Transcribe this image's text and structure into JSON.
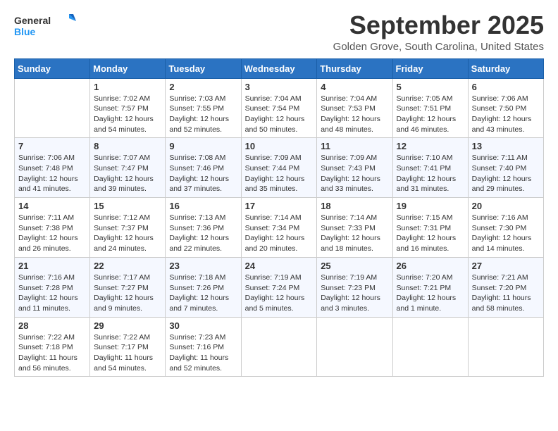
{
  "logo": {
    "line1": "General",
    "line2": "Blue"
  },
  "title": "September 2025",
  "location": "Golden Grove, South Carolina, United States",
  "days_of_week": [
    "Sunday",
    "Monday",
    "Tuesday",
    "Wednesday",
    "Thursday",
    "Friday",
    "Saturday"
  ],
  "weeks": [
    [
      {
        "day": "",
        "info": ""
      },
      {
        "day": "1",
        "info": "Sunrise: 7:02 AM\nSunset: 7:57 PM\nDaylight: 12 hours and 54 minutes."
      },
      {
        "day": "2",
        "info": "Sunrise: 7:03 AM\nSunset: 7:55 PM\nDaylight: 12 hours and 52 minutes."
      },
      {
        "day": "3",
        "info": "Sunrise: 7:04 AM\nSunset: 7:54 PM\nDaylight: 12 hours and 50 minutes."
      },
      {
        "day": "4",
        "info": "Sunrise: 7:04 AM\nSunset: 7:53 PM\nDaylight: 12 hours and 48 minutes."
      },
      {
        "day": "5",
        "info": "Sunrise: 7:05 AM\nSunset: 7:51 PM\nDaylight: 12 hours and 46 minutes."
      },
      {
        "day": "6",
        "info": "Sunrise: 7:06 AM\nSunset: 7:50 PM\nDaylight: 12 hours and 43 minutes."
      }
    ],
    [
      {
        "day": "7",
        "info": "Sunrise: 7:06 AM\nSunset: 7:48 PM\nDaylight: 12 hours and 41 minutes."
      },
      {
        "day": "8",
        "info": "Sunrise: 7:07 AM\nSunset: 7:47 PM\nDaylight: 12 hours and 39 minutes."
      },
      {
        "day": "9",
        "info": "Sunrise: 7:08 AM\nSunset: 7:46 PM\nDaylight: 12 hours and 37 minutes."
      },
      {
        "day": "10",
        "info": "Sunrise: 7:09 AM\nSunset: 7:44 PM\nDaylight: 12 hours and 35 minutes."
      },
      {
        "day": "11",
        "info": "Sunrise: 7:09 AM\nSunset: 7:43 PM\nDaylight: 12 hours and 33 minutes."
      },
      {
        "day": "12",
        "info": "Sunrise: 7:10 AM\nSunset: 7:41 PM\nDaylight: 12 hours and 31 minutes."
      },
      {
        "day": "13",
        "info": "Sunrise: 7:11 AM\nSunset: 7:40 PM\nDaylight: 12 hours and 29 minutes."
      }
    ],
    [
      {
        "day": "14",
        "info": "Sunrise: 7:11 AM\nSunset: 7:38 PM\nDaylight: 12 hours and 26 minutes."
      },
      {
        "day": "15",
        "info": "Sunrise: 7:12 AM\nSunset: 7:37 PM\nDaylight: 12 hours and 24 minutes."
      },
      {
        "day": "16",
        "info": "Sunrise: 7:13 AM\nSunset: 7:36 PM\nDaylight: 12 hours and 22 minutes."
      },
      {
        "day": "17",
        "info": "Sunrise: 7:14 AM\nSunset: 7:34 PM\nDaylight: 12 hours and 20 minutes."
      },
      {
        "day": "18",
        "info": "Sunrise: 7:14 AM\nSunset: 7:33 PM\nDaylight: 12 hours and 18 minutes."
      },
      {
        "day": "19",
        "info": "Sunrise: 7:15 AM\nSunset: 7:31 PM\nDaylight: 12 hours and 16 minutes."
      },
      {
        "day": "20",
        "info": "Sunrise: 7:16 AM\nSunset: 7:30 PM\nDaylight: 12 hours and 14 minutes."
      }
    ],
    [
      {
        "day": "21",
        "info": "Sunrise: 7:16 AM\nSunset: 7:28 PM\nDaylight: 12 hours and 11 minutes."
      },
      {
        "day": "22",
        "info": "Sunrise: 7:17 AM\nSunset: 7:27 PM\nDaylight: 12 hours and 9 minutes."
      },
      {
        "day": "23",
        "info": "Sunrise: 7:18 AM\nSunset: 7:26 PM\nDaylight: 12 hours and 7 minutes."
      },
      {
        "day": "24",
        "info": "Sunrise: 7:19 AM\nSunset: 7:24 PM\nDaylight: 12 hours and 5 minutes."
      },
      {
        "day": "25",
        "info": "Sunrise: 7:19 AM\nSunset: 7:23 PM\nDaylight: 12 hours and 3 minutes."
      },
      {
        "day": "26",
        "info": "Sunrise: 7:20 AM\nSunset: 7:21 PM\nDaylight: 12 hours and 1 minute."
      },
      {
        "day": "27",
        "info": "Sunrise: 7:21 AM\nSunset: 7:20 PM\nDaylight: 11 hours and 58 minutes."
      }
    ],
    [
      {
        "day": "28",
        "info": "Sunrise: 7:22 AM\nSunset: 7:18 PM\nDaylight: 11 hours and 56 minutes."
      },
      {
        "day": "29",
        "info": "Sunrise: 7:22 AM\nSunset: 7:17 PM\nDaylight: 11 hours and 54 minutes."
      },
      {
        "day": "30",
        "info": "Sunrise: 7:23 AM\nSunset: 7:16 PM\nDaylight: 11 hours and 52 minutes."
      },
      {
        "day": "",
        "info": ""
      },
      {
        "day": "",
        "info": ""
      },
      {
        "day": "",
        "info": ""
      },
      {
        "day": "",
        "info": ""
      }
    ]
  ]
}
